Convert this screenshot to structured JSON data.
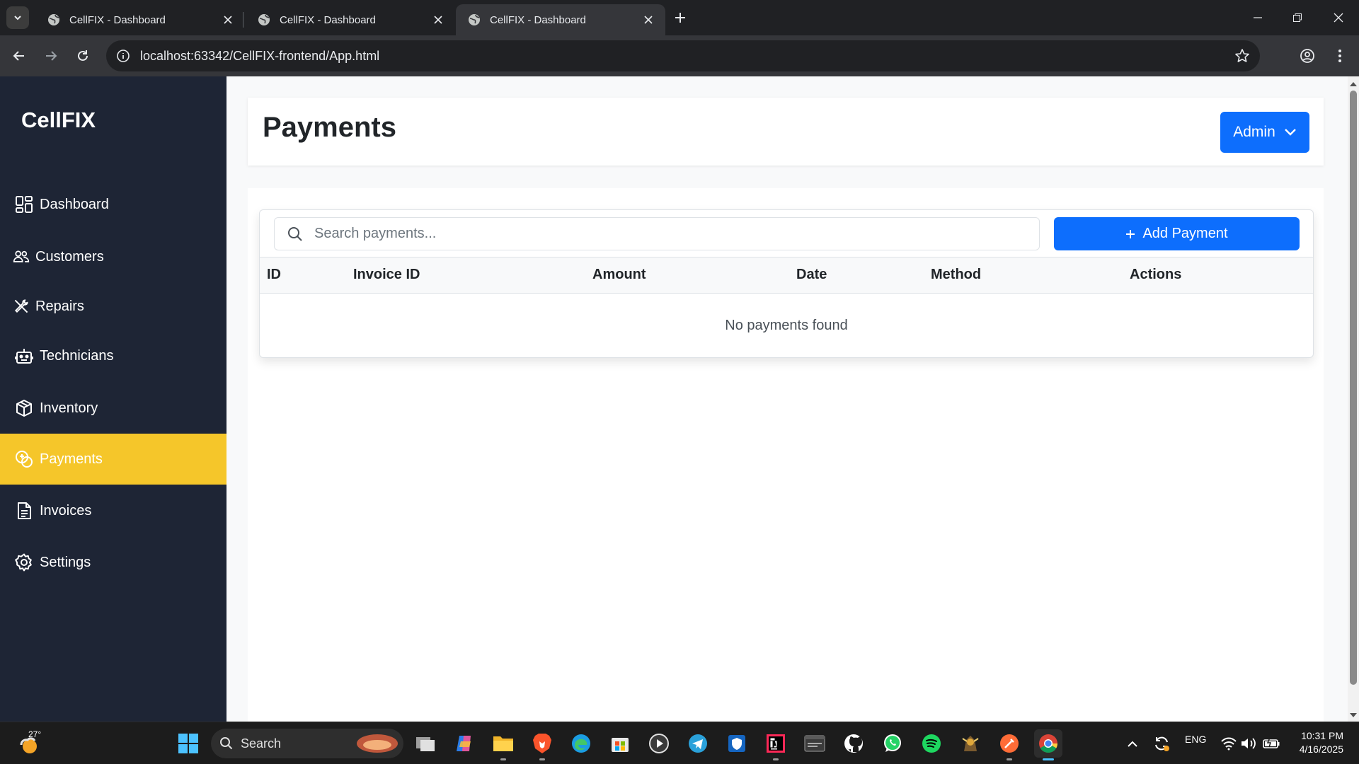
{
  "browser": {
    "tabs": [
      {
        "title": "CellFIX - Dashboard"
      },
      {
        "title": "CellFIX - Dashboard"
      },
      {
        "title": "CellFIX - Dashboard"
      }
    ],
    "url": "localhost:63342/CellFIX-frontend/App.html"
  },
  "app": {
    "brand": "CellFIX",
    "nav": [
      {
        "label": "Dashboard",
        "icon": "dashboard-grid-icon"
      },
      {
        "label": "Customers",
        "icon": "people-icon"
      },
      {
        "label": "Repairs",
        "icon": "tools-icon"
      },
      {
        "label": "Technicians",
        "icon": "robot-icon"
      },
      {
        "label": "Inventory",
        "icon": "box-icon"
      },
      {
        "label": "Payments",
        "icon": "coins-icon",
        "active": true
      },
      {
        "label": "Invoices",
        "icon": "document-icon"
      },
      {
        "label": "Settings",
        "icon": "gear-icon"
      }
    ],
    "active_color": "#f5c62a",
    "sidebar_color": "#1e2535",
    "accent_color": "#0d6efd",
    "header": {
      "title": "Payments",
      "user_button": "Admin"
    },
    "payments": {
      "search_placeholder": "Search payments...",
      "add_button": "Add Payment",
      "columns": [
        "ID",
        "Invoice ID",
        "Amount",
        "Date",
        "Method",
        "Actions"
      ],
      "rows": [],
      "empty_message": "No payments found"
    }
  },
  "taskbar": {
    "weather_temp": "27°",
    "search_label": "Search",
    "language": "ENG",
    "time": "10:31 PM",
    "date": "4/16/2025"
  }
}
